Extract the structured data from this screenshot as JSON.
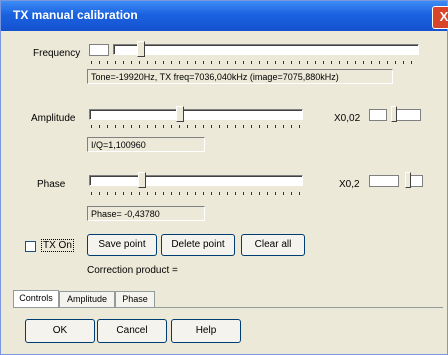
{
  "window": {
    "title": "TX manual calibration",
    "close_glyph": "X"
  },
  "frequency": {
    "label": "Frequency",
    "readout": "Tone=-19920Hz, TX freq=7036,040kHz (image=7075,880kHz)",
    "position": 0.08
  },
  "amplitude": {
    "label": "Amplitude",
    "readout": "I/Q=1,100960",
    "multiplier": "X0,02",
    "position": 0.42
  },
  "phase": {
    "label": "Phase",
    "readout": "Phase= -0,43780",
    "multiplier": "X0,2",
    "position": 0.24
  },
  "controls": {
    "tx_on_label": "TX On",
    "save_point": "Save point",
    "delete_point": "Delete point",
    "clear_all": "Clear all",
    "correction_product": "Correction product ="
  },
  "tabs": [
    {
      "label": "Controls",
      "active": true
    },
    {
      "label": "Amplitude",
      "active": false
    },
    {
      "label": "Phase",
      "active": false
    }
  ],
  "footer": {
    "ok": "OK",
    "cancel": "Cancel",
    "help": "Help"
  }
}
